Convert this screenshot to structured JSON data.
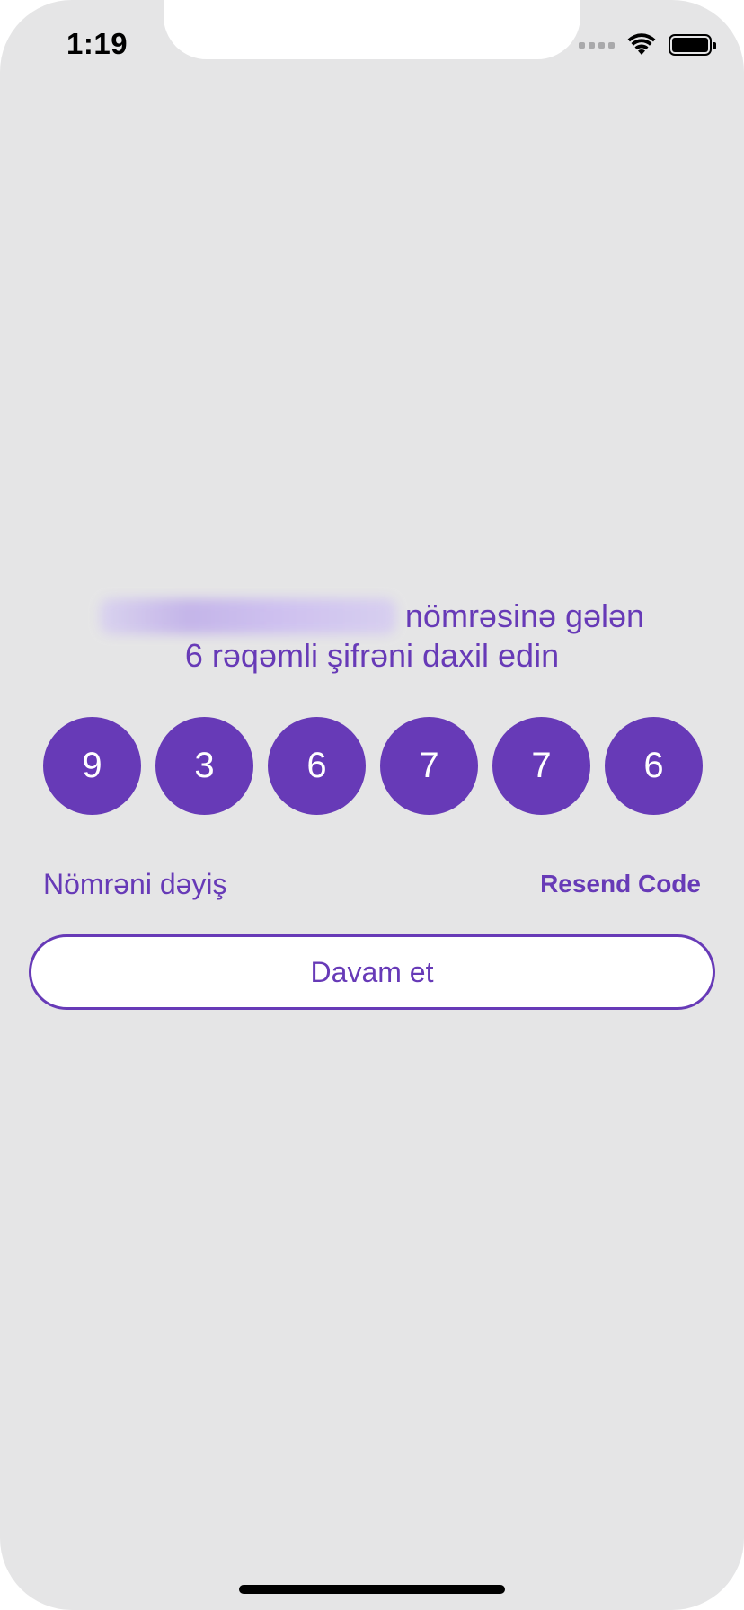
{
  "status_bar": {
    "time": "1:19",
    "icons": [
      "signal-icon",
      "wifi-icon",
      "battery-icon"
    ]
  },
  "prompt": {
    "phone_number_blurred": "",
    "line1_suffix": "nömrəsinə gələn",
    "line2": "6 rəqəmli şifrəni daxil edin"
  },
  "otp": {
    "digits": [
      "9",
      "3",
      "6",
      "7",
      "7",
      "6"
    ]
  },
  "actions": {
    "change_number_label": "Nömrəni dəyiş",
    "resend_label": "Resend Code",
    "continue_label": "Davam et"
  },
  "colors": {
    "accent": "#673ab7",
    "background": "#e5e5e6",
    "button_bg": "#ffffff"
  }
}
